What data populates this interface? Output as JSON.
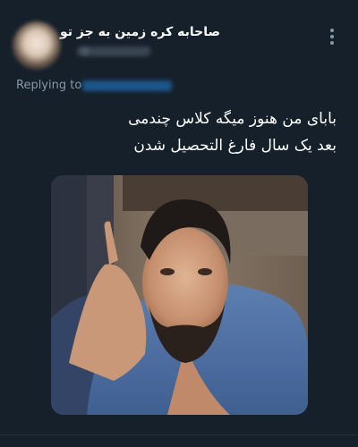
{
  "tweet": {
    "display_name": "صاحابه کره زمین به جز تو",
    "handle": "@",
    "replying_to_label": "Replying to",
    "text_line1": "بابای من هنوز میگه کلاس چندمی",
    "text_line2": "بعد یک سال فارغ التحصیل شدن"
  },
  "icons": {
    "more": "more-vertical-icon"
  },
  "colors": {
    "background": "#15202b",
    "secondary_text": "#8899a6",
    "link": "#1d9bf0",
    "primary_text": "#ffffff"
  }
}
